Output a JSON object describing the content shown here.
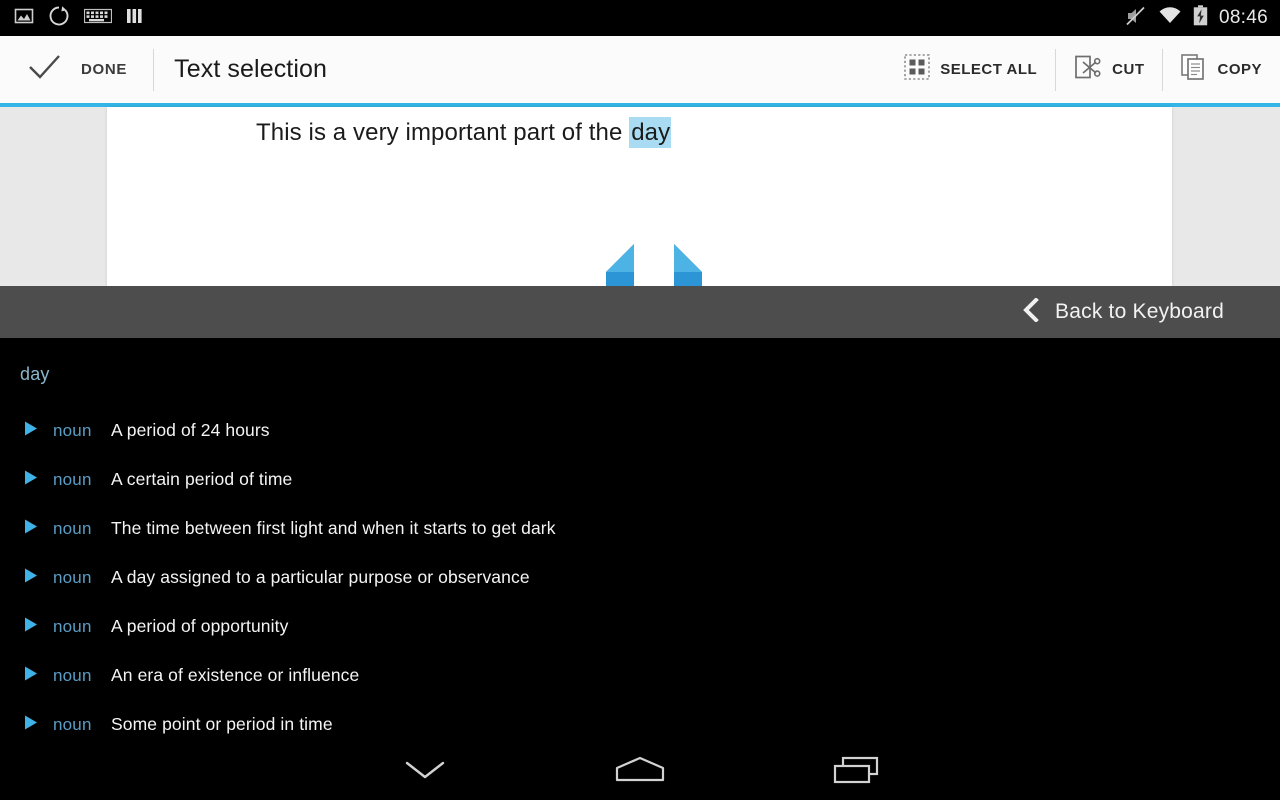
{
  "statusbar": {
    "icons_left": [
      "image-icon",
      "sync-icon",
      "keyboard-icon",
      "sim-bars-icon"
    ],
    "icons_right": [
      "mute-icon",
      "wifi-icon",
      "battery-charging-icon"
    ],
    "time": "08:46"
  },
  "actionbar": {
    "done_label": "DONE",
    "done_icon": "checkmark-icon",
    "title": "Text selection",
    "accent_color": "#33b5e5",
    "actions": [
      {
        "label": "SELECT ALL",
        "icon": "select-all-icon"
      },
      {
        "label": "CUT",
        "icon": "scissors-icon"
      },
      {
        "label": "COPY",
        "icon": "copy-pages-icon"
      }
    ]
  },
  "document": {
    "text_before": "This is a very important part of the ",
    "selected_text": "day",
    "selection_highlight_color": "#a9dcf2",
    "handle_color": "#2b95d6",
    "page_background": "#ffffff",
    "area_background": "#e8e8e8"
  },
  "keyboard_bar": {
    "label": "Back to Keyboard",
    "icon": "chevron-left-icon",
    "background": "#4d4d4d"
  },
  "dictionary": {
    "word": "day",
    "word_color": "#8ab6cc",
    "entries": [
      {
        "play_icon": "play-triangle-icon",
        "pos": "noun",
        "definition": "A period of 24 hours"
      },
      {
        "play_icon": "play-triangle-icon",
        "pos": "noun",
        "definition": "A certain period of time"
      },
      {
        "play_icon": "play-triangle-icon",
        "pos": "noun",
        "definition": "The time between first light and when it starts to get dark"
      },
      {
        "play_icon": "play-triangle-icon",
        "pos": "noun",
        "definition": "A day assigned to a particular purpose or observance"
      },
      {
        "play_icon": "play-triangle-icon",
        "pos": "noun",
        "definition": "A period of opportunity"
      },
      {
        "play_icon": "play-triangle-icon",
        "pos": "noun",
        "definition": "An era of existence or influence"
      },
      {
        "play_icon": "play-triangle-icon",
        "pos": "noun",
        "definition": "Some point or period in time"
      }
    ]
  },
  "navbar": {
    "buttons": [
      {
        "name": "hide-keyboard-button",
        "icon": "chevron-down-icon"
      },
      {
        "name": "home-button",
        "icon": "home-icon"
      },
      {
        "name": "recents-button",
        "icon": "recents-icon"
      }
    ]
  }
}
